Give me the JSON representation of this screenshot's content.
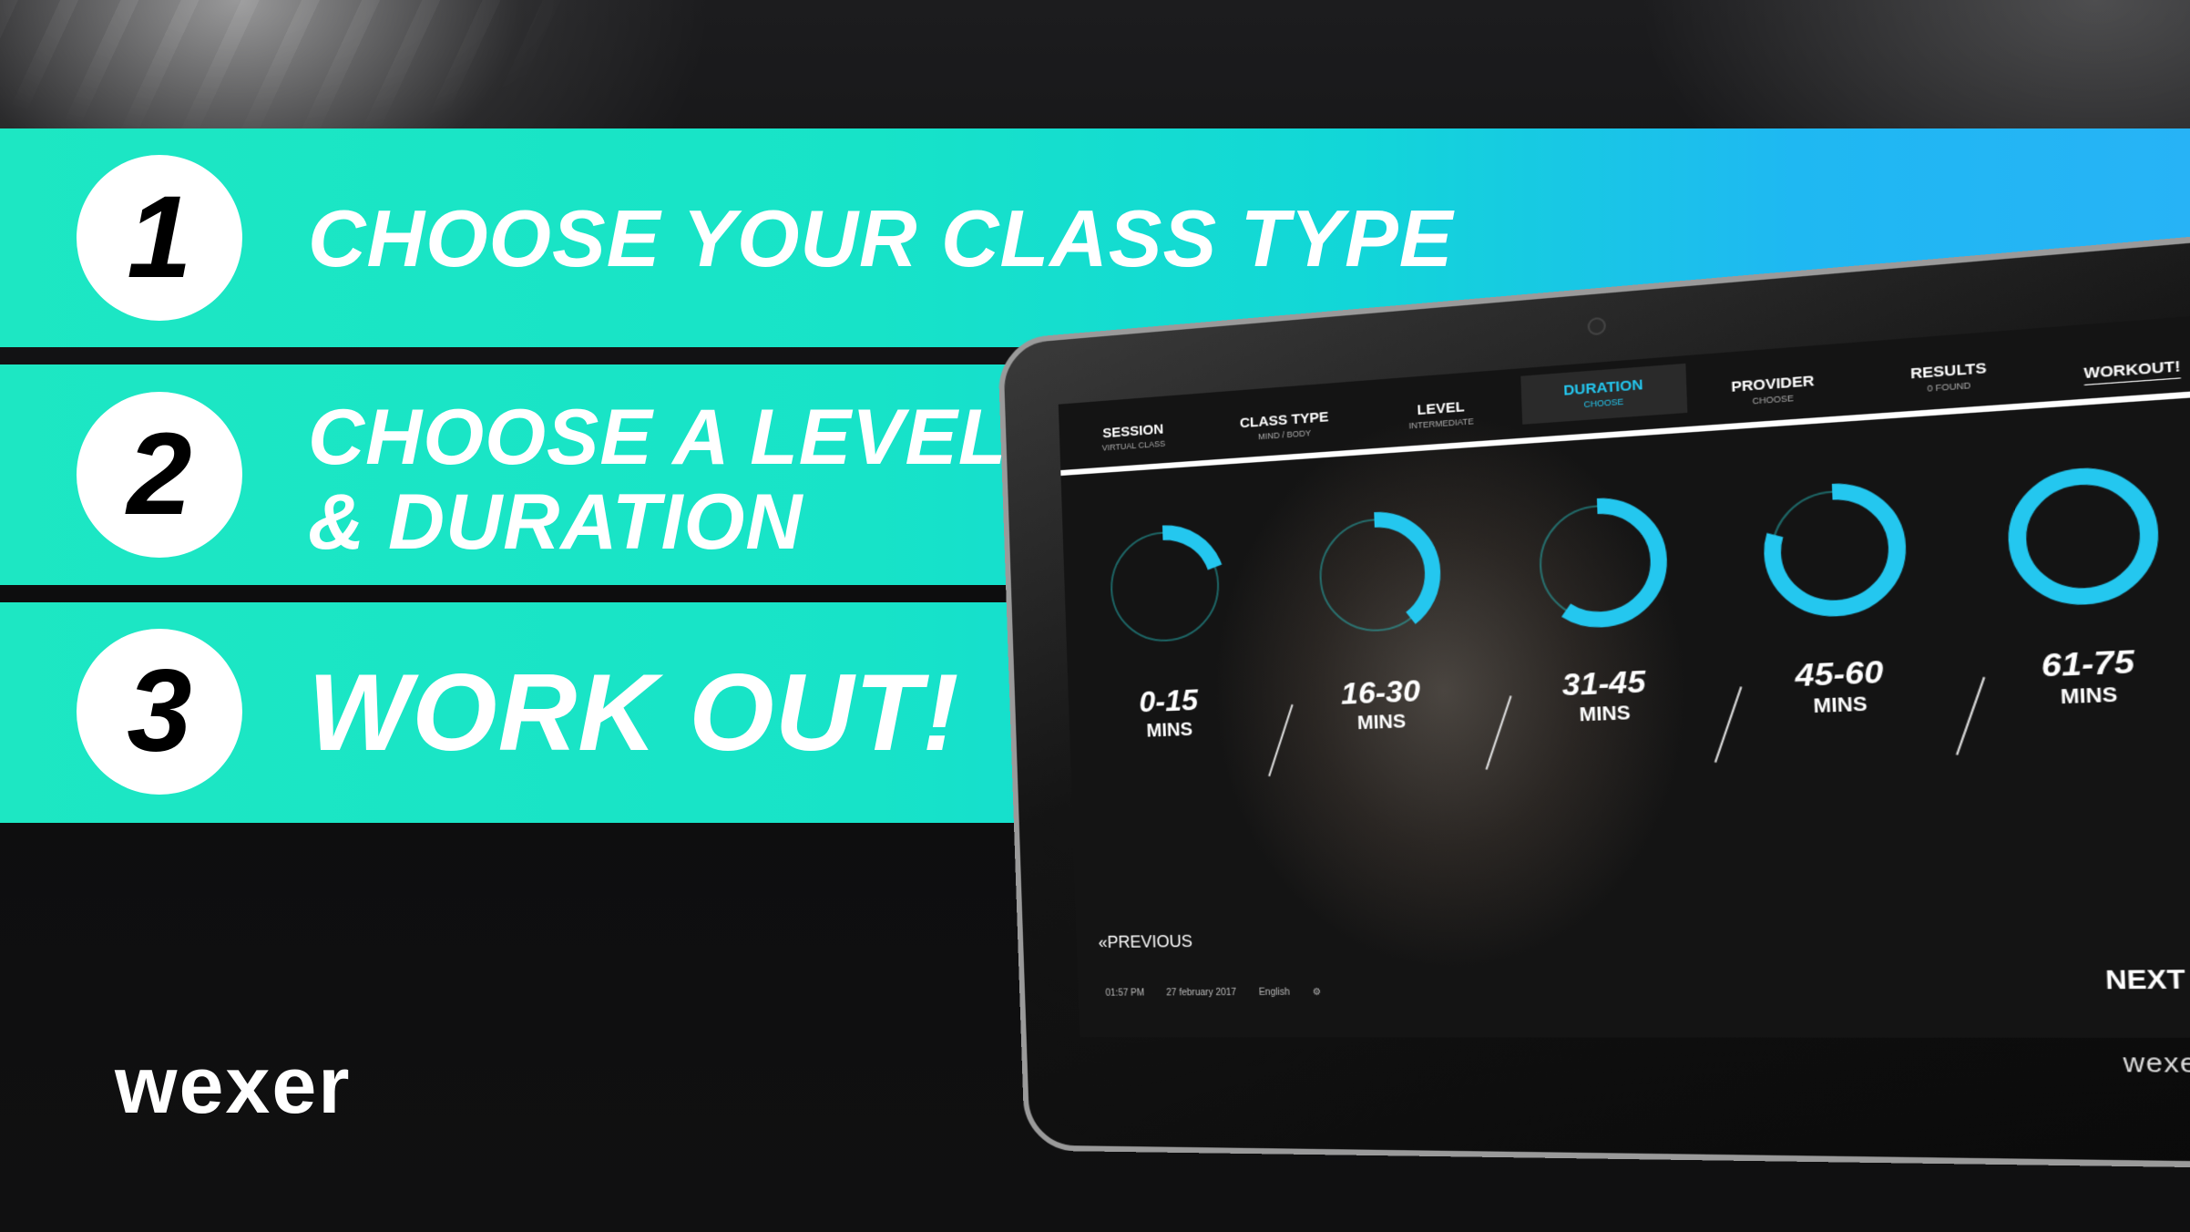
{
  "steps": [
    {
      "number": "1",
      "title_line1": "CHOOSE YOUR CLASS TYPE",
      "title_line2": ""
    },
    {
      "number": "2",
      "title_line1": "CHOOSE A LEVEL",
      "title_line2": "& DURATION"
    },
    {
      "number": "3",
      "title_line1": "WORK OUT!",
      "title_line2": ""
    }
  ],
  "brand": "wexer",
  "colors": {
    "band_start": "#1de7c3",
    "band_end": "#27b3f6",
    "accent": "#24c7ef"
  },
  "tablet": {
    "nav": [
      {
        "label": "SESSION",
        "sub": "VIRTUAL CLASS"
      },
      {
        "label": "CLASS TYPE",
        "sub": "MIND / BODY"
      },
      {
        "label": "LEVEL",
        "sub": "INTERMEDIATE"
      },
      {
        "label": "DURATION",
        "sub": "CHOOSE"
      },
      {
        "label": "PROVIDER",
        "sub": "CHOOSE"
      },
      {
        "label": "RESULTS",
        "sub": "0 FOUND"
      },
      {
        "label": "WORKOUT!",
        "sub": ""
      }
    ],
    "durations": [
      {
        "value": "0-15",
        "unit": "MINS",
        "fill": 0.2
      },
      {
        "value": "16-30",
        "unit": "MINS",
        "fill": 0.4
      },
      {
        "value": "31-45",
        "unit": "MINS",
        "fill": 0.6
      },
      {
        "value": "45-60",
        "unit": "MINS",
        "fill": 0.8
      },
      {
        "value": "61-75",
        "unit": "MINS",
        "fill": 1.0
      }
    ],
    "previous_label": "PREVIOUS",
    "next_label": "NEXT",
    "status": {
      "time": "01:57 PM",
      "date": "27 february 2017",
      "language": "English",
      "icon": "gear-icon"
    },
    "brand": "wexer"
  }
}
